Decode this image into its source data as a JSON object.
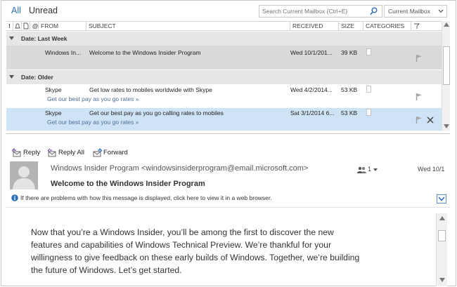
{
  "filters": {
    "all": "All",
    "unread": "Unread"
  },
  "search": {
    "placeholder": "Search Current Mailbox (Ctrl+E)",
    "scope": "Current Mailbox"
  },
  "columns": {
    "from": "FROM",
    "subject": "SUBJECT",
    "received": "RECEIVED",
    "size": "SIZE",
    "categories": "CATEGORIES"
  },
  "groups": [
    {
      "label": "Date: Last Week"
    },
    {
      "label": "Date: Older"
    }
  ],
  "messages": [
    {
      "from": "Windows In...",
      "subject": "Welcome to the Windows Insider Program",
      "received": "Wed 10/1/201...",
      "size": "39 KB",
      "preview": ""
    },
    {
      "from": "Skype",
      "subject": "Get low rates to mobiles worldwide with Skype",
      "received": "Wed 4/2/2014...",
      "size": "53 KB",
      "preview": "Get our best pay as you go rates »"
    },
    {
      "from": "Skype",
      "subject": "Get our best pay as you go calling rates to mobiles",
      "received": "Sat 3/1/2014 6...",
      "size": "53 KB",
      "preview": "Get our best pay as you go rates »"
    }
  ],
  "actions": {
    "reply": "Reply",
    "reply_all": "Reply All",
    "forward": "Forward"
  },
  "reading": {
    "sender": "Windows Insider Program <windowsinsiderprogram@email.microsoft.com>",
    "subject": "Welcome to the Windows Insider Program",
    "people_count": "1",
    "date": "Wed 10/1",
    "info": "If there are problems with how this message is displayed, click here to view it in a web browser.",
    "body_lines": [
      "Now that you’re a Windows Insider, you’ll be among the first to discover the new",
      "features and capabilities of Windows Technical Preview. We’re thankful for your",
      "willingness to give feedback on these early builds of Windows. Together, we’re building",
      "the future of Windows. Let’s get started."
    ]
  },
  "colors": {
    "accent": "#2b6fb7",
    "selected_row": "#cfe3f6",
    "group_header": "#e6e6e6",
    "preview_text": "#4a6e96"
  }
}
